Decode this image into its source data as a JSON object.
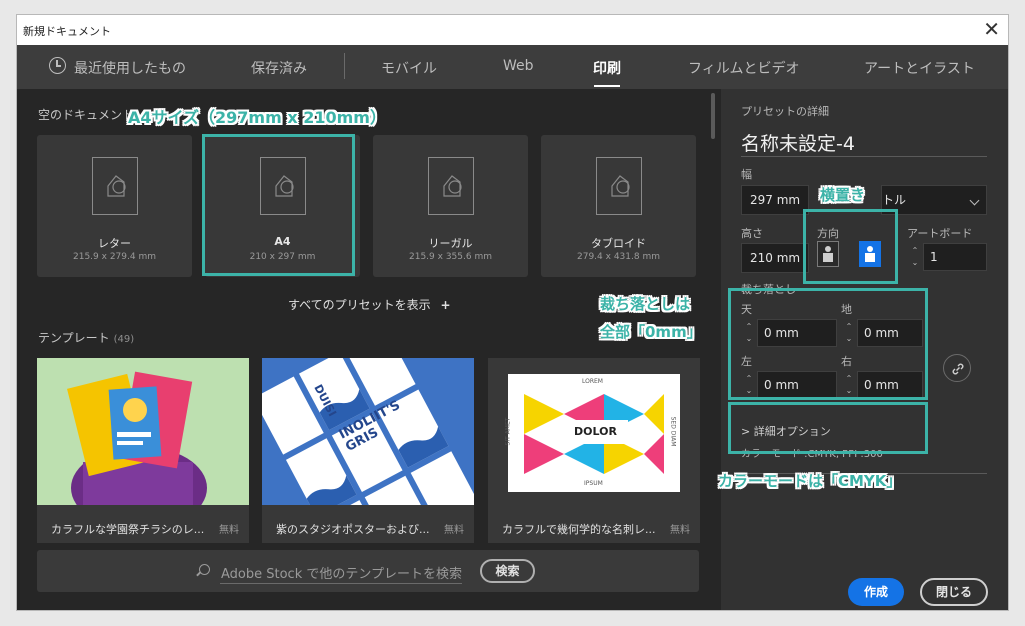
{
  "window": {
    "title": "新規ドキュメント",
    "close_glyph": "✕"
  },
  "tabs": [
    {
      "label": "最近使用したもの",
      "active": false
    },
    {
      "label": "保存済み",
      "active": false
    },
    {
      "label": "モバイル",
      "active": false
    },
    {
      "label": "Web",
      "active": false
    },
    {
      "label": "印刷",
      "active": true
    },
    {
      "label": "フィルムとビデオ",
      "active": false
    },
    {
      "label": "アートとイラスト",
      "active": false
    }
  ],
  "blank_docs": {
    "section_label": "空のドキュメント",
    "items": [
      {
        "name": "レター",
        "size": "215.9 x 279.4 mm"
      },
      {
        "name": "A4",
        "size": "210 x 297 mm"
      },
      {
        "name": "リーガル",
        "size": "215.9 x 355.6 mm"
      },
      {
        "name": "タブロイド",
        "size": "279.4 x 431.8 mm"
      }
    ],
    "show_all": "すべてのプリセットを表示"
  },
  "templates": {
    "section_label": "テンプレート",
    "count": "(49)",
    "items": [
      {
        "title": "カラフルな学園祭チラシのレ...",
        "price": "無料"
      },
      {
        "title": "紫のスタジオポスターおよび...",
        "price": "無料"
      },
      {
        "title": "カラフルで幾何学的な名刺レ...",
        "price": "無料"
      }
    ],
    "card2_text": "INOLIIT'S GRIS",
    "card2_side": "DUISI",
    "card3_words": {
      "top": "LOREM",
      "center": "DOLOR",
      "bottom": "IPSUM",
      "left": "SIT AMET",
      "right": "SED DIAM"
    }
  },
  "search": {
    "placeholder_brand": "Adobe Stock",
    "placeholder_rest": " で他のテンプレートを検索",
    "button": "検索"
  },
  "preset": {
    "header": "プリセットの詳細",
    "name": "名称未設定-4",
    "width_label": "幅",
    "width_value": "297 mm",
    "unit_value": "トル",
    "height_label": "高さ",
    "height_value": "210 mm",
    "orientation_label": "方向",
    "artboard_label": "アートボード",
    "artboard_value": "1",
    "bleed_label": "裁ち落とし",
    "bleed_top_label": "天",
    "bleed_bottom_label": "地",
    "bleed_left_label": "左",
    "bleed_right_label": "右",
    "bleed_top": "0 mm",
    "bleed_bottom": "0 mm",
    "bleed_left": "0 mm",
    "bleed_right": "0 mm",
    "advanced": "> 詳細オプション",
    "color_mode": "カラーモード :CMYK, PPI :300",
    "create_button": "作成",
    "close_button": "閉じる"
  },
  "annotations": {
    "a4": "A4サイズ（297mm x 210mm）",
    "landscape": "横置き",
    "bleed_line1": "裁ち落としは",
    "bleed_line2": "全部「0mm」",
    "cmyk": "カラーモードは「CMYK」"
  },
  "colors": {
    "accent": "#1473e6",
    "annotation": "#3cb3a8",
    "panel_dark": "#262626",
    "panel": "#323232"
  }
}
